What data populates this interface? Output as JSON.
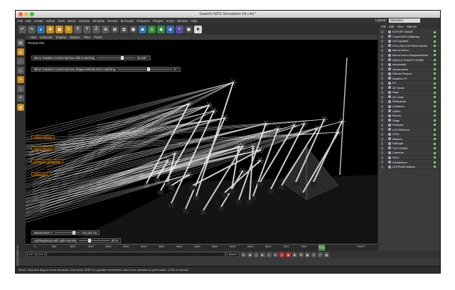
{
  "window": {
    "title": "Saatchi NDS Simulation 64.c4d *"
  },
  "menu": [
    "File",
    "Edit",
    "Create",
    "Select",
    "Tools",
    "Mesh",
    "Animate",
    "Simulate",
    "Render",
    "MoGraph",
    "Character",
    "Plugins",
    "Script",
    "Window",
    "Help"
  ],
  "layout": {
    "label": "Layout:",
    "value": "Standard"
  },
  "viewport_menu": [
    "View",
    "Cameras",
    "Display",
    "Options",
    "Filter",
    "Panel"
  ],
  "viewport": {
    "label": "Perspective"
  },
  "sliders": [
    {
      "label": "Mirror Rotation Control Xpresso.Mirror Banking",
      "value": "32.239 °",
      "fill": 0.63
    },
    {
      "label": "Mirror Rotation Control Xpresso.DiagnoseMode.Mirror Banking",
      "value": "0 °",
      "fill": 0.55
    }
  ],
  "overlay_buttons": [
    "Show Tribune",
    "Show Sharpys",
    "Show QC Clearance",
    "Show QCs"
  ],
  "bottom_sliders": [
    {
      "label": "MainScreen Y",
      "value": "724.432 cm",
      "fill": 0.72
    },
    {
      "label": "LightingSetup.Hall Light Intensity",
      "value": "30 %",
      "fill": 0.3
    }
  ],
  "objects_panel": {
    "tabs": [
      "File",
      "Edit",
      "View",
      "Objects"
    ],
    "items": [
      "EXPORT MODE",
      "ColorLEDFromBitmap",
      "LED Updater",
      "FOLLOW COPTERS MODE",
      "MirrorControl",
      "MirrorControl.DiagnoseMode",
      "SINGLE SHARPY MODE",
      "deprecated",
      "Quadcopters",
      "Effector Shapes",
      "disabled FX",
      "FX",
      "QC Spots",
      "Rays",
      "QC Hulls",
      "Reflections",
      "Collisions",
      "HalPin",
      "Mirrors",
      "Stage",
      "Sharpies",
      "LED Effectors",
      "LEDs",
      "Masters",
      "HallLight",
      "TOP DOWN",
      "Cameras",
      "NULL",
      "Architecture",
      "LEDPixelPositions"
    ]
  },
  "timeline": {
    "ticks": [
      "0",
      "500",
      "1000",
      "1500",
      "2000",
      "2500",
      "3000",
      "3500",
      "4000",
      "4500",
      "5000",
      "5500",
      "6000",
      "6500",
      "7000",
      "7500",
      "8000"
    ],
    "current_frame": "7018",
    "end_label": "7018 F"
  },
  "transport": {
    "start": "0 F",
    "current": "8018 F",
    "fps_field": "0 F"
  },
  "status": {
    "text": "Move: Click and drag to move elements. Hold down SHIFT to quantize movement / add to the selection in point mode, CTRL to remove."
  },
  "brand": {
    "label": "MAXON CINEMA 4D"
  },
  "colors": {
    "accent_orange": "#f1a020",
    "viewport_bg": "#000000",
    "panel_bg": "#3b3b3b"
  }
}
